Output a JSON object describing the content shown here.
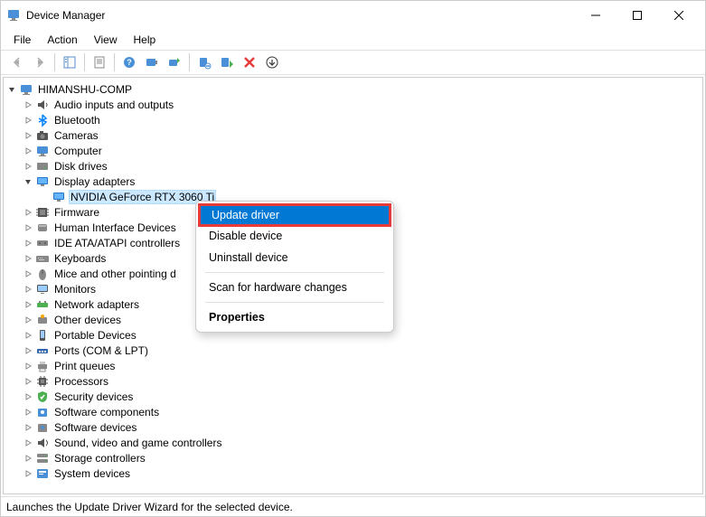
{
  "window": {
    "title": "Device Manager"
  },
  "menu": {
    "file": "File",
    "action": "Action",
    "view": "View",
    "help": "Help"
  },
  "tree": {
    "root": "HIMANSHU-COMP",
    "items": [
      {
        "label": "Audio inputs and outputs",
        "icon": "audio"
      },
      {
        "label": "Bluetooth",
        "icon": "bluetooth"
      },
      {
        "label": "Cameras",
        "icon": "camera"
      },
      {
        "label": "Computer",
        "icon": "computer"
      },
      {
        "label": "Disk drives",
        "icon": "disk"
      },
      {
        "label": "Display adapters",
        "icon": "display",
        "expanded": true,
        "children": [
          {
            "label": "NVIDIA GeForce RTX 3060 Ti",
            "icon": "display",
            "selected": true
          }
        ]
      },
      {
        "label": "Firmware",
        "icon": "firmware"
      },
      {
        "label": "Human Interface Devices",
        "icon": "hid"
      },
      {
        "label": "IDE ATA/ATAPI controllers",
        "icon": "ide"
      },
      {
        "label": "Keyboards",
        "icon": "keyboard"
      },
      {
        "label": "Mice and other pointing devices",
        "icon": "mouse",
        "truncated": "Mice and other pointing d"
      },
      {
        "label": "Monitors",
        "icon": "monitor"
      },
      {
        "label": "Network adapters",
        "icon": "network"
      },
      {
        "label": "Other devices",
        "icon": "other"
      },
      {
        "label": "Portable Devices",
        "icon": "portable"
      },
      {
        "label": "Ports (COM & LPT)",
        "icon": "port"
      },
      {
        "label": "Print queues",
        "icon": "print"
      },
      {
        "label": "Processors",
        "icon": "processor"
      },
      {
        "label": "Security devices",
        "icon": "security"
      },
      {
        "label": "Software components",
        "icon": "softcomp"
      },
      {
        "label": "Software devices",
        "icon": "softdev"
      },
      {
        "label": "Sound, video and game controllers",
        "icon": "sound"
      },
      {
        "label": "Storage controllers",
        "icon": "storage"
      },
      {
        "label": "System devices",
        "icon": "system"
      }
    ]
  },
  "context_menu": {
    "update": "Update driver",
    "disable": "Disable device",
    "uninstall": "Uninstall device",
    "scan": "Scan for hardware changes",
    "properties": "Properties"
  },
  "status": {
    "text": "Launches the Update Driver Wizard for the selected device."
  }
}
